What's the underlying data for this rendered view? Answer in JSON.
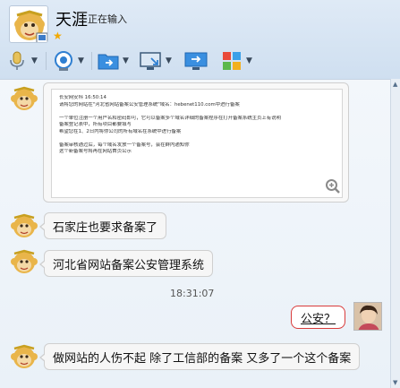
{
  "contact": {
    "name": "天涯",
    "status": "正在输入",
    "star": "★"
  },
  "chat": {
    "image_message": {
      "lines": [
        "长安网安科  16:50:14",
        "请将您的网站在\"河北省网站备案公安管理系统\"域名：hebenet110.com中进行备案",
        "",
        "一个单位注册一个用户名和密码即可，它可以备案多个域名详细的备案程序在打开备案系统主页上有说明",
        "备案登记表中，所有项目都要填写",
        "希望您在1、2日内将你公司的所有域名在系统中进行备案",
        "",
        "备案审核通过后，每个域名发放一个备案号，会在群内通知你",
        "这个新备案号将再在网站首页公示"
      ]
    },
    "messages": [
      {
        "text": "石家庄也要求备案了"
      },
      {
        "text": "河北省网站备案公安管理系统"
      }
    ],
    "timestamp": "18:31:07",
    "self_message": "公安？",
    "last_message": "做网站的人伤不起   除了工信部的备案 又多了一个这个备案"
  },
  "icons": {
    "mic": "microphone-icon",
    "camera": "video-camera-icon",
    "folder": "file-transfer-icon",
    "screen": "remote-desktop-icon",
    "share": "screen-share-icon",
    "apps": "apps-grid-icon",
    "zoom": "zoom-in-icon"
  },
  "colors": {
    "accent": "#2f7fd1",
    "self_bubble_border": "#d93b3b",
    "star": "#f2a900"
  }
}
